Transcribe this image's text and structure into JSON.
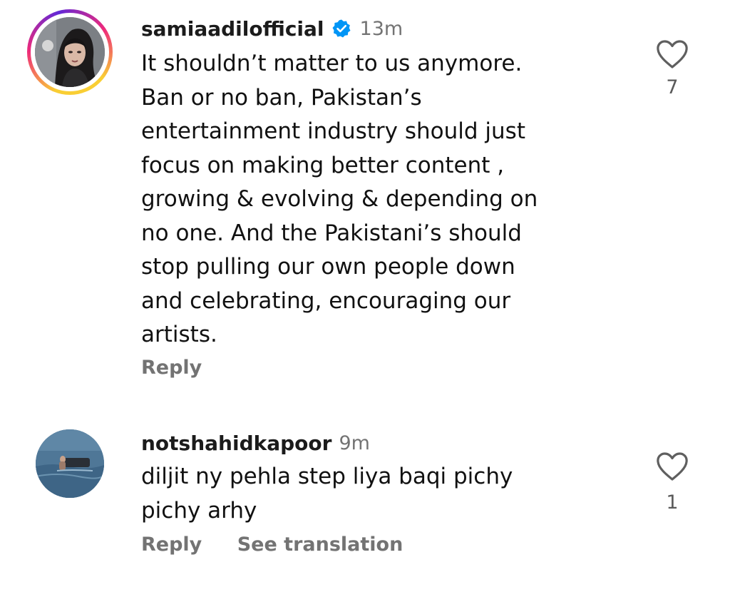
{
  "comments": [
    {
      "username": "samiaadilofficial",
      "verified": true,
      "time": "13m",
      "text_lines": [
        "It shouldn’t matter to us anymore.",
        "Ban or no ban, Pakistan’s",
        "entertainment industry should just",
        "focus on making better content ,",
        "growing & evolving & depending on",
        "no one. And the Pakistani’s should",
        "stop pulling our own people down",
        "and celebrating, encouraging our",
        "artists."
      ],
      "reply_label": "Reply",
      "like_count": "7",
      "icons": {
        "like": "heart-outline-icon",
        "verified": "verified-badge-icon"
      },
      "colors": {
        "verified": "#0095f6",
        "ring": [
          "#f9ce34",
          "#ee2a7b",
          "#6228d7"
        ]
      }
    },
    {
      "username": "notshahidkapoor",
      "verified": false,
      "time": "9m",
      "text_lines": [
        "diljit ny pehla step liya baqi pichy",
        "pichy arhy"
      ],
      "reply_label": "Reply",
      "translation_label": "See translation",
      "like_count": "1",
      "icons": {
        "like": "heart-outline-icon"
      }
    }
  ]
}
